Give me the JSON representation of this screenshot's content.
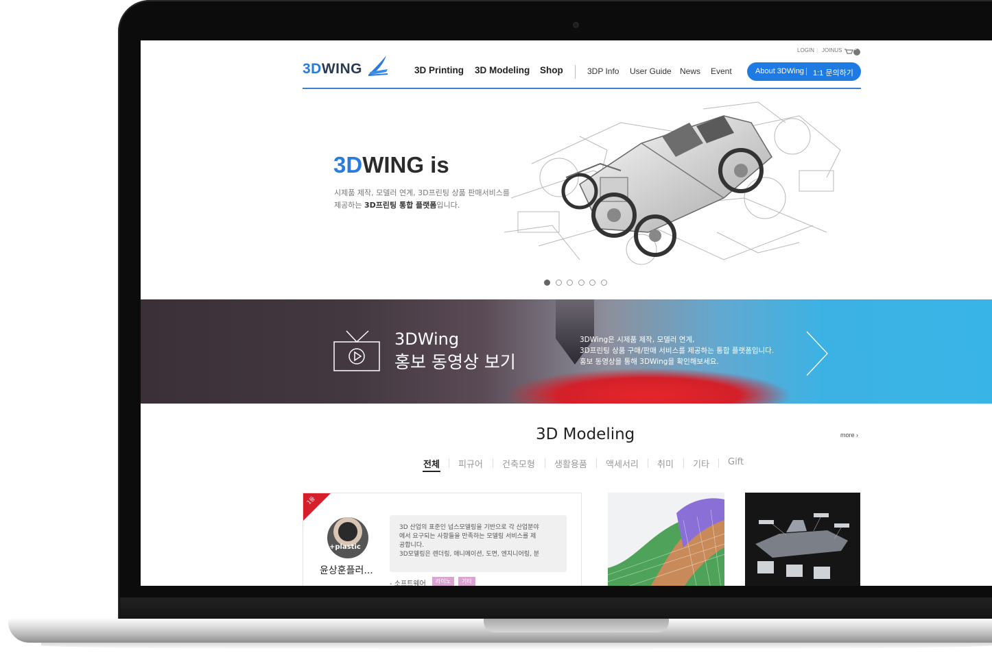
{
  "util": {
    "login": "LOGIN",
    "join": "JOINUS",
    "cart_count": "0"
  },
  "logo": {
    "part1": "3D",
    "part2": "WING"
  },
  "nav": {
    "main": [
      "3D Printing",
      "3D Modeling",
      "Shop"
    ],
    "sub": [
      "3DP Info",
      "User Guide",
      "News",
      "Event"
    ],
    "pill_left": "About 3DWing",
    "pill_right": "1:1 문의하기"
  },
  "hero": {
    "title_a": "3D",
    "title_b": "WING is",
    "desc_line1": "시제품 제작, 모델러 연계, 3D프린팅 상품 판매서비스를",
    "desc_line2_pre": "제공하는 ",
    "desc_line2_bold": "3D프린팅 통합 플랫폼",
    "desc_line2_post": "입니다.",
    "slide_count": 6,
    "active_slide": 1
  },
  "banner": {
    "title1": "3DWing",
    "title2": "홍보 동영상 보기",
    "desc1": "3DWing은 시제품 제작, 모델러 연계,",
    "desc2": "3D프린팅 상품 구매/판매 서비스를 제공하는 통합 플랫폼입니다.",
    "desc3": "홍보 동영상을 통해 3DWing을 확인해보세요."
  },
  "modeling": {
    "title": "3D Modeling",
    "more": "more ›",
    "categories": [
      "전체",
      "피규어",
      "건축모형",
      "생활용품",
      "액세서리",
      "취미",
      "기타",
      "Gift"
    ],
    "active_category": "전체"
  },
  "card": {
    "ribbon": "1등",
    "avatar_text": "+plastic",
    "name": "윤상훈플러...",
    "bubble1": "3D 산업의 표준인 넙스모델링을 기반으로 각 산업분야",
    "bubble2": "에서 요구되는 사항들을 만족하는 모델링 서비스를 제",
    "bubble3": "공합니다.",
    "bubble4": "3D모델링은 렌더링, 애니메이션, 도면, 엔지니어링, 분",
    "field": "- 소프트웨어",
    "tags": [
      "라이노",
      "기타"
    ]
  },
  "colors": {
    "accent": "#1f7be4",
    "logo_blue": "#2a7bde",
    "ribbon": "#d61f2b",
    "tag": "#d9a4d0"
  }
}
